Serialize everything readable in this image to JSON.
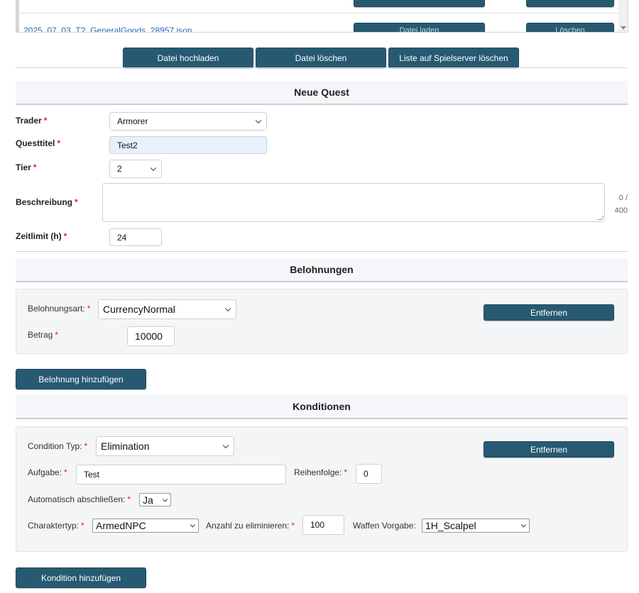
{
  "file_list": {
    "row_file_name": "2025_07_03_T2_GeneralGoods_28957.json",
    "row_button_1": "Datei laden",
    "row_button_2": "Löschen"
  },
  "file_actions": {
    "upload": "Datei hochladen",
    "delete": "Datei löschen",
    "delete_server_list": "Liste auf Spielserver löschen"
  },
  "new_quest": {
    "title": "Neue Quest",
    "required_mark": "*",
    "trader": {
      "label": "Trader",
      "value": "Armorer"
    },
    "quest_title": {
      "label": "Questtitel",
      "value": "Test2"
    },
    "tier": {
      "label": "Tier",
      "value": "2"
    },
    "description": {
      "label": "Beschreibung",
      "value": "",
      "counter_a": "0 /",
      "counter_b": "400"
    },
    "time_limit": {
      "label": "Zeitlimit (h)",
      "value": "24"
    }
  },
  "rewards": {
    "title": "Belohnungen",
    "type_label": "Belohnungsart:",
    "type_value": "CurrencyNormal",
    "amount_label": "Betrag",
    "amount_value": "10000",
    "remove_button": "Entfernen",
    "add_button": "Belohnung hinzufügen"
  },
  "conditions": {
    "title": "Konditionen",
    "type_label": "Condition Typ:",
    "type_value": "Elimination",
    "task_label": "Aufgabe:",
    "task_value": "Test",
    "order_label": "Reihenfolge:",
    "order_value": "0",
    "auto_complete_label": "Automatisch abschließen:",
    "auto_complete_value": "Ja",
    "char_type_label": "Charaktertyp:",
    "char_type_value": "ArmedNPC",
    "kill_count_label": "Anzahl zu eliminieren:",
    "kill_count_value": "100",
    "weapon_label": "Waffen Vorgabe:",
    "weapon_value": "1H_Scalpel",
    "remove_button": "Entfernen",
    "add_button": "Kondition hinzufügen"
  },
  "colors": {
    "button": "#275a72",
    "required": "#d22222",
    "link": "#2a6db3",
    "header_bg": "#f4f6f9",
    "input_active_bg": "#e8f0fe"
  },
  "icons": [
    "chevron-down-icon",
    "scroll-down-arrow-icon",
    "resize-grip-icon"
  ]
}
